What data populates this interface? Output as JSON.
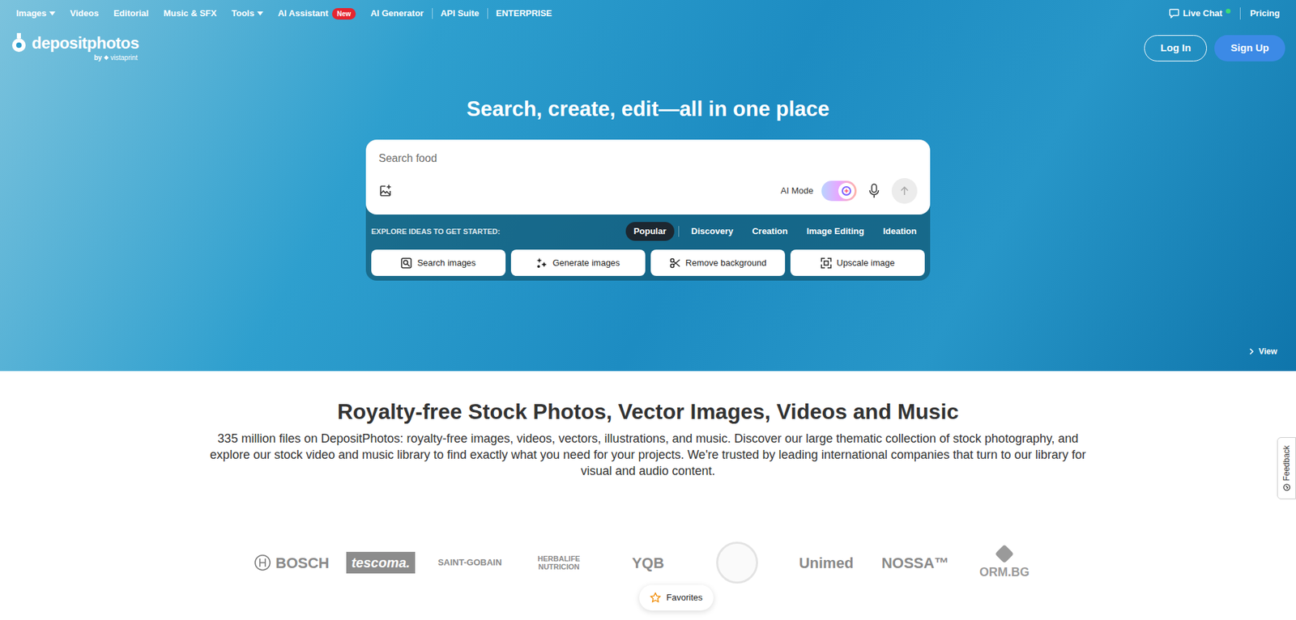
{
  "nav": {
    "items": [
      {
        "label": "Images",
        "dropdown": true
      },
      {
        "label": "Videos",
        "dropdown": false
      },
      {
        "label": "Editorial",
        "dropdown": false
      },
      {
        "label": "Music & SFX",
        "dropdown": false
      },
      {
        "label": "Tools",
        "dropdown": true
      },
      {
        "label": "AI Assistant",
        "dropdown": false,
        "badge": "New"
      },
      {
        "label": "AI Generator",
        "dropdown": false
      },
      {
        "label": "API Suite",
        "dropdown": false
      },
      {
        "label": "ENTERPRISE",
        "dropdown": false
      }
    ],
    "live_chat": {
      "label": "Live Chat",
      "online": true
    },
    "pricing": "Pricing"
  },
  "logo": {
    "name": "depositphotos",
    "by": "by",
    "partner": "vistaprint"
  },
  "auth": {
    "login": "Log In",
    "signup": "Sign Up"
  },
  "hero": {
    "heading": "Search, create, edit—all in one place",
    "view": "View"
  },
  "search": {
    "placeholder": "Search food",
    "ai_mode": {
      "label": "AI Mode",
      "on": true
    }
  },
  "explore": {
    "label": "EXPLORE IDEAS TO GET STARTED:",
    "tabs": [
      {
        "label": "Popular",
        "selected": true
      },
      {
        "label": "Discovery",
        "selected": false
      },
      {
        "label": "Creation",
        "selected": false
      },
      {
        "label": "Image Editing",
        "selected": false
      },
      {
        "label": "Ideation",
        "selected": false
      }
    ],
    "actions": [
      "Search images",
      "Generate images",
      "Remove background",
      "Upscale image"
    ]
  },
  "intro": {
    "title": "Royalty-free Stock Photos, Vector Images, Videos and Music",
    "text": "335 million files on DepositPhotos: royalty-free images, videos, vectors, illustrations, and music. Discover our large thematic collection of stock photography, and explore our stock video and music library to find exactly what you need for your projects. We're trusted by leading international companies that turn to our library for visual and audio content."
  },
  "clients": [
    {
      "name": "BOSCH",
      "kind": "wordmark"
    },
    {
      "name": "tescoma.",
      "kind": "boxed"
    },
    {
      "name": "SAINT-GOBAIN",
      "kind": "wordmark"
    },
    {
      "name": "HERBALIFE NUTRICION",
      "kind": "wordmark"
    },
    {
      "name": "YQB",
      "kind": "wordmark"
    },
    {
      "kind": "seal"
    },
    {
      "name": "Unimed",
      "kind": "wordmark"
    },
    {
      "name": "NOSSA™",
      "kind": "wordmark"
    },
    {
      "name": "ORM.BG",
      "kind": "wordmark"
    }
  ],
  "favorites": "Favorites",
  "feedback": "Feedback"
}
